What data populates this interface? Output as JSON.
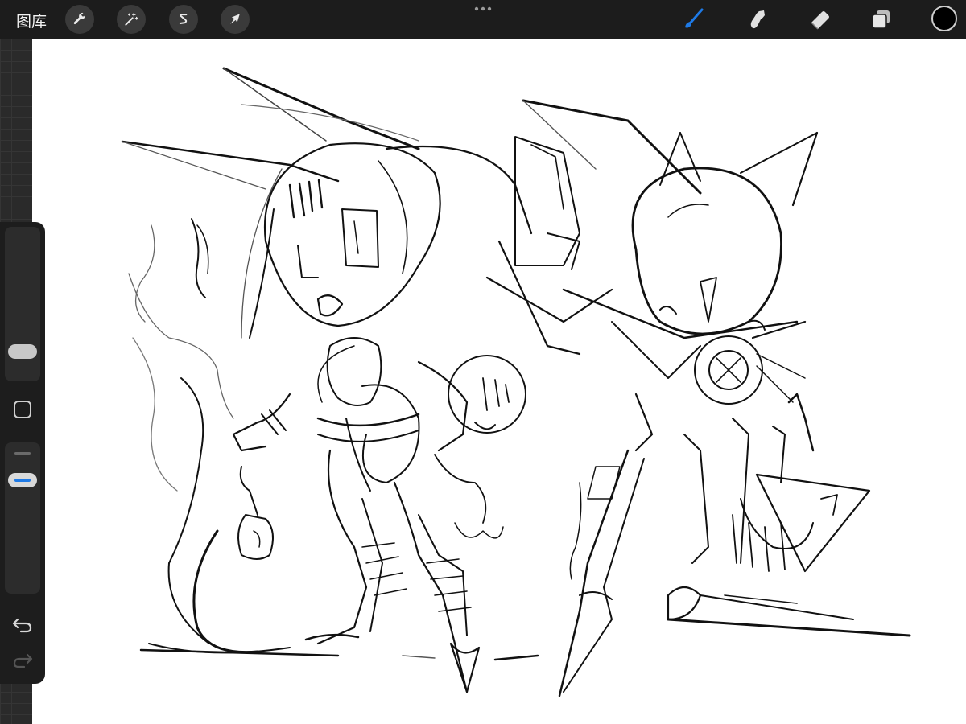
{
  "topbar": {
    "gallery_label": "图库",
    "left_tools": [
      "wrench-icon",
      "magic-wand-icon",
      "selection-icon",
      "transform-arrow-icon"
    ],
    "right_tools": [
      "brush-icon",
      "smudge-icon",
      "eraser-icon",
      "layers-icon"
    ],
    "active_tool": "brush",
    "current_color": "#000000"
  },
  "sidebar": {
    "tools": [
      "brush-size-slider",
      "modify-button",
      "opacity-slider",
      "undo-icon",
      "redo-icon"
    ]
  },
  "colors": {
    "accent": "#1e7ae6",
    "canvas": "#ffffff",
    "chrome": "#1c1c1c"
  }
}
